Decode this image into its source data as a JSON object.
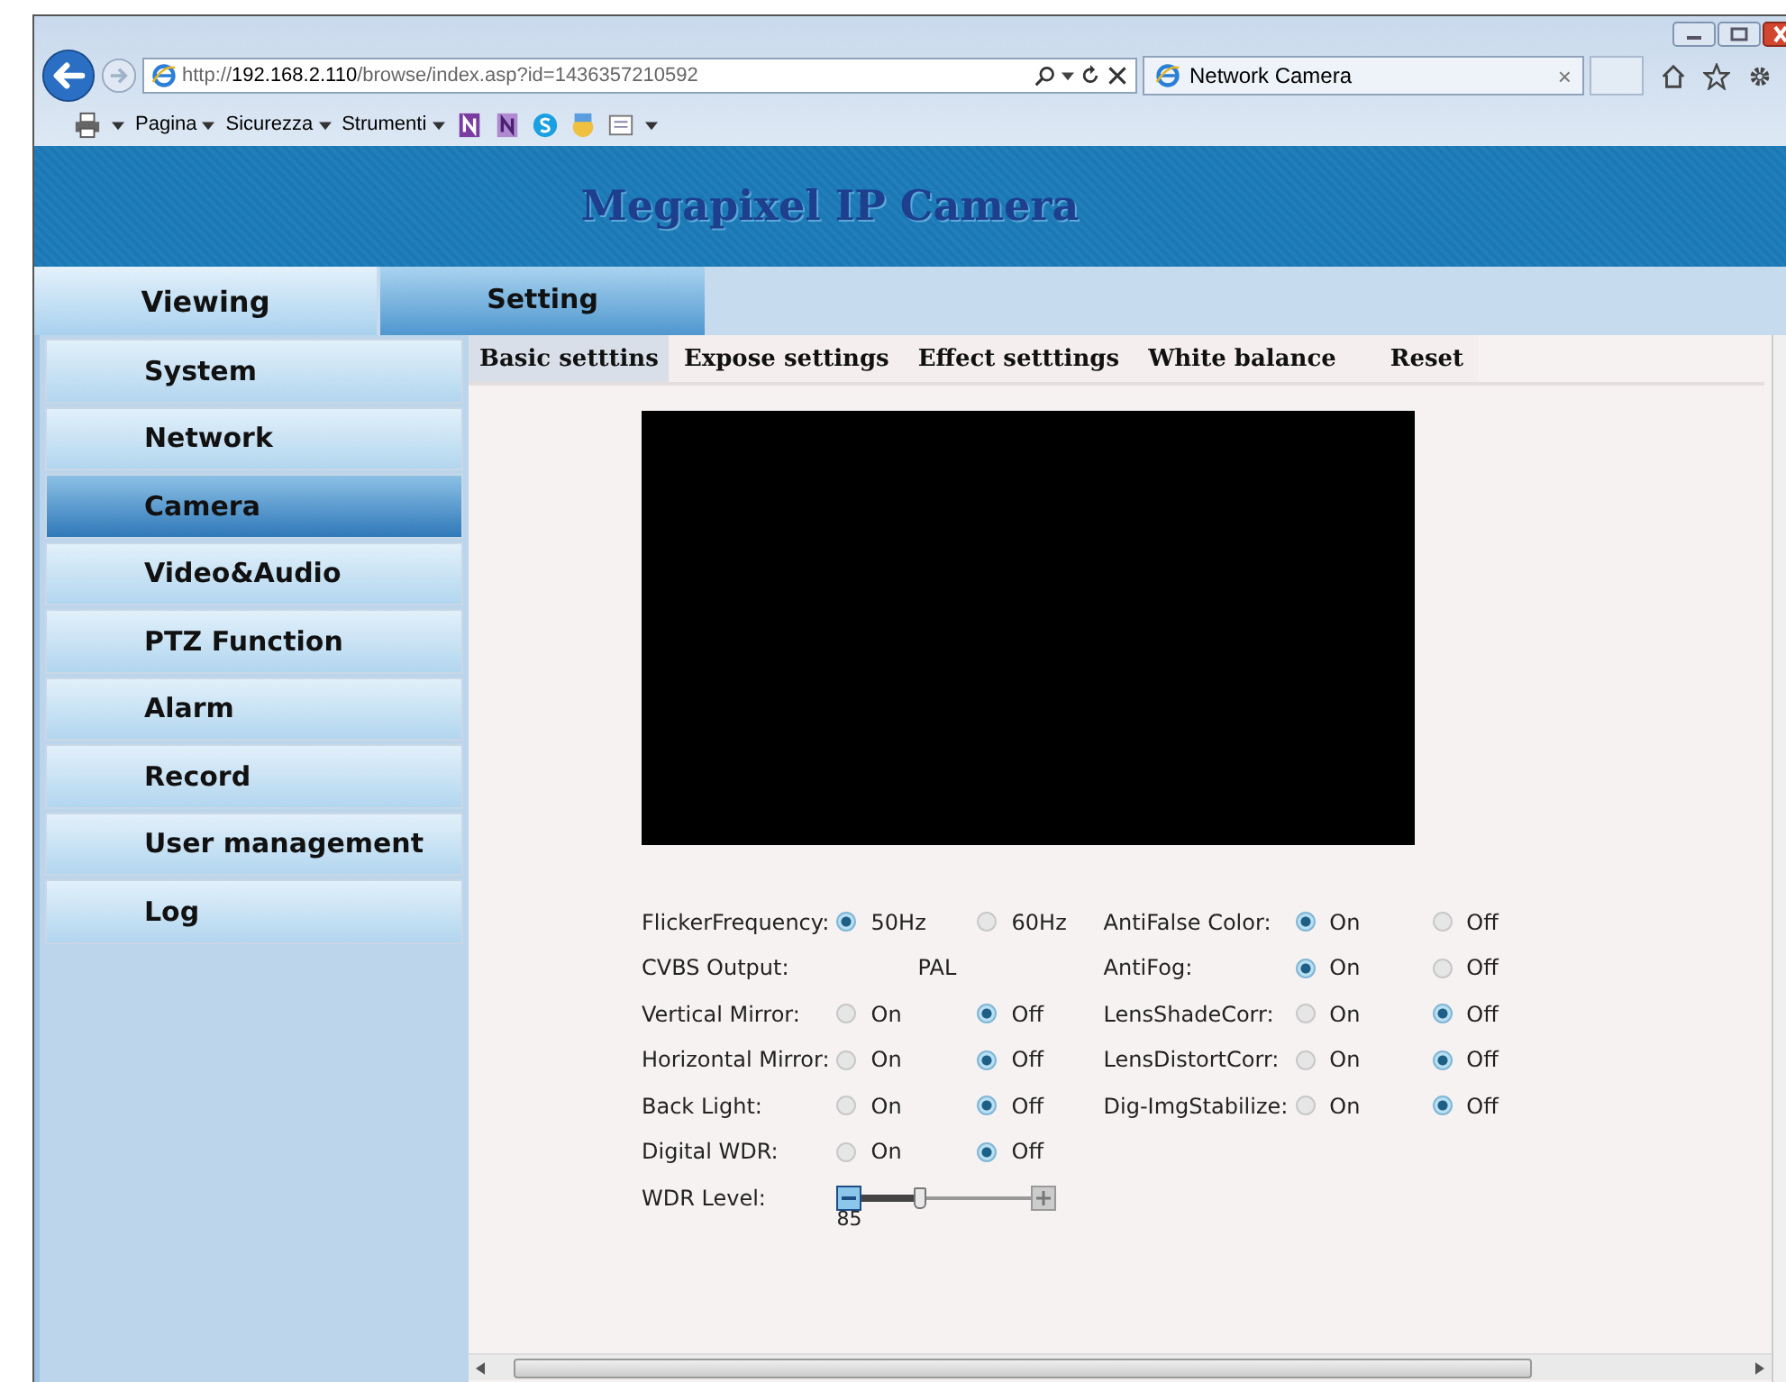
{
  "browser": {
    "url": "http://**192.168.2.110**/browse/index.asp?id=1436357210592",
    "tab_title": "Network Camera",
    "tab_close": "×",
    "menus": [
      "Pagina",
      "Sicurezza",
      "Strumenti"
    ]
  },
  "banner": {
    "title": "Megapixel IP Camera"
  },
  "main_tabs": [
    {
      "label": "Viewing",
      "selected": false
    },
    {
      "label": "Setting",
      "selected": true
    }
  ],
  "sidebar": {
    "items": [
      {
        "label": "System",
        "selected": false
      },
      {
        "label": "Network",
        "selected": false
      },
      {
        "label": "Camera",
        "selected": true
      },
      {
        "label": "Video&Audio",
        "selected": false
      },
      {
        "label": "PTZ Function",
        "selected": false
      },
      {
        "label": "Alarm",
        "selected": false
      },
      {
        "label": "Record",
        "selected": false
      },
      {
        "label": "User management",
        "selected": false
      },
      {
        "label": "Log",
        "selected": false
      }
    ]
  },
  "sub_tabs": [
    {
      "label": "Basic setttins",
      "selected": true
    },
    {
      "label": "Expose settings",
      "selected": false
    },
    {
      "label": "Effect setttings",
      "selected": false
    },
    {
      "label": "White balance",
      "selected": false
    },
    {
      "label": "Reset",
      "selected": false
    }
  ],
  "form": {
    "left": [
      {
        "kind": "radio",
        "label": "FlickerFrequency:",
        "options": [
          {
            "label": "50Hz",
            "selected": true
          },
          {
            "label": "60Hz",
            "selected": false
          }
        ]
      },
      {
        "kind": "text",
        "label": "CVBS Output:",
        "value": "PAL"
      },
      {
        "kind": "radio",
        "label": "Vertical Mirror:",
        "options": [
          {
            "label": "On",
            "selected": false
          },
          {
            "label": "Off",
            "selected": true
          }
        ]
      },
      {
        "kind": "radio",
        "label": "Horizontal Mirror:",
        "options": [
          {
            "label": "On",
            "selected": false
          },
          {
            "label": "Off",
            "selected": true
          }
        ]
      },
      {
        "kind": "radio",
        "label": "Back Light:",
        "options": [
          {
            "label": "On",
            "selected": false
          },
          {
            "label": "Off",
            "selected": true
          }
        ]
      },
      {
        "kind": "radio",
        "label": "Digital WDR:",
        "options": [
          {
            "label": "On",
            "selected": false
          },
          {
            "label": "Off",
            "selected": true
          }
        ]
      },
      {
        "kind": "slider",
        "label": "WDR Level:",
        "level": 0.35,
        "reading": "85"
      }
    ],
    "right": [
      {
        "kind": "radio",
        "label": "AntiFalse Color:",
        "options": [
          {
            "label": "On",
            "selected": true
          },
          {
            "label": "Off",
            "selected": false
          }
        ]
      },
      {
        "kind": "radio",
        "label": "AntiFog:",
        "options": [
          {
            "label": "On",
            "selected": true
          },
          {
            "label": "Off",
            "selected": false
          }
        ]
      },
      {
        "kind": "radio",
        "label": "LensShadeCorr:",
        "options": [
          {
            "label": "On",
            "selected": false
          },
          {
            "label": "Off",
            "selected": true
          }
        ]
      },
      {
        "kind": "radio",
        "label": "LensDistortCorr:",
        "options": [
          {
            "label": "On",
            "selected": false
          },
          {
            "label": "Off",
            "selected": true
          }
        ]
      },
      {
        "kind": "radio",
        "label": "Dig-ImgStabilize:",
        "options": [
          {
            "label": "On",
            "selected": false
          },
          {
            "label": "Off",
            "selected": true
          }
        ]
      }
    ]
  }
}
